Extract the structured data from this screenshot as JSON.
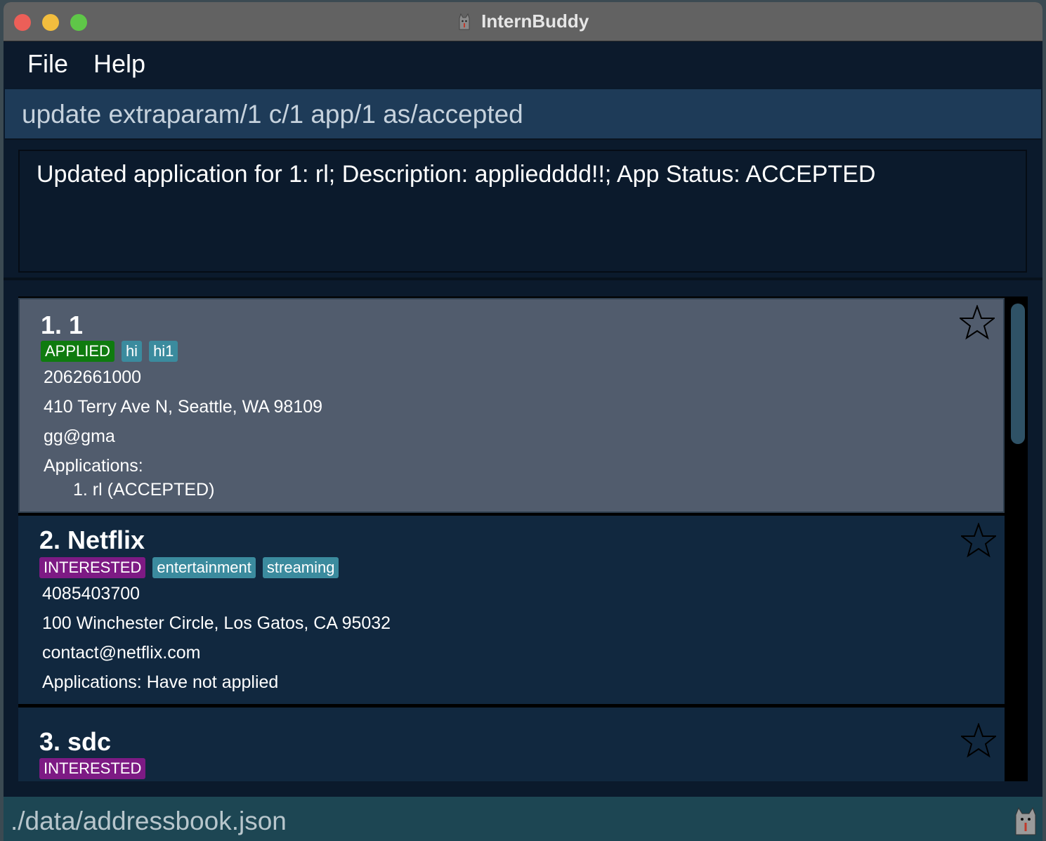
{
  "window": {
    "title": "InternBuddy"
  },
  "menu": {
    "file": "File",
    "help": "Help"
  },
  "command": {
    "value": "update extraparam/1 c/1 app/1 as/accepted"
  },
  "result": {
    "text": "Updated application for 1: rl; Description: appliedddd!!; App Status: ACCEPTED"
  },
  "companies": [
    {
      "title": "1. 1",
      "status": "APPLIED",
      "tags": [
        "hi",
        "hi1"
      ],
      "phone": "2062661000",
      "address": "410 Terry Ave N, Seattle, WA 98109",
      "email": "gg@gma",
      "applications_label": "Applications:",
      "application_item": "1. rl (ACCEPTED)"
    },
    {
      "title": "2. Netflix",
      "status": "INTERESTED",
      "tags": [
        "entertainment",
        "streaming"
      ],
      "phone": "4085403700",
      "address": "100 Winchester Circle, Los Gatos, CA 95032",
      "email": "contact@netflix.com",
      "applications_label": "Applications: Have not applied"
    },
    {
      "title": "3. sdc",
      "status": "INTERESTED"
    }
  ],
  "status_bar": {
    "path": "./data/addressbook.json"
  },
  "colors": {
    "applied": "#0f7b0f",
    "interested": "#7d1a84",
    "tag": "#3b8b9e",
    "selected_card": "#515c6d",
    "card": "#11283f"
  }
}
